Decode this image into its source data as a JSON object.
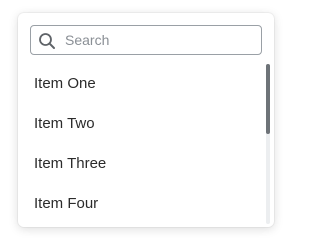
{
  "search": {
    "placeholder": "Search",
    "value": "",
    "icon": "search-icon"
  },
  "items": [
    {
      "label": "Item One"
    },
    {
      "label": "Item Two"
    },
    {
      "label": "Item Three"
    },
    {
      "label": "Item Four"
    }
  ],
  "scrollbar": {
    "position": 0
  }
}
